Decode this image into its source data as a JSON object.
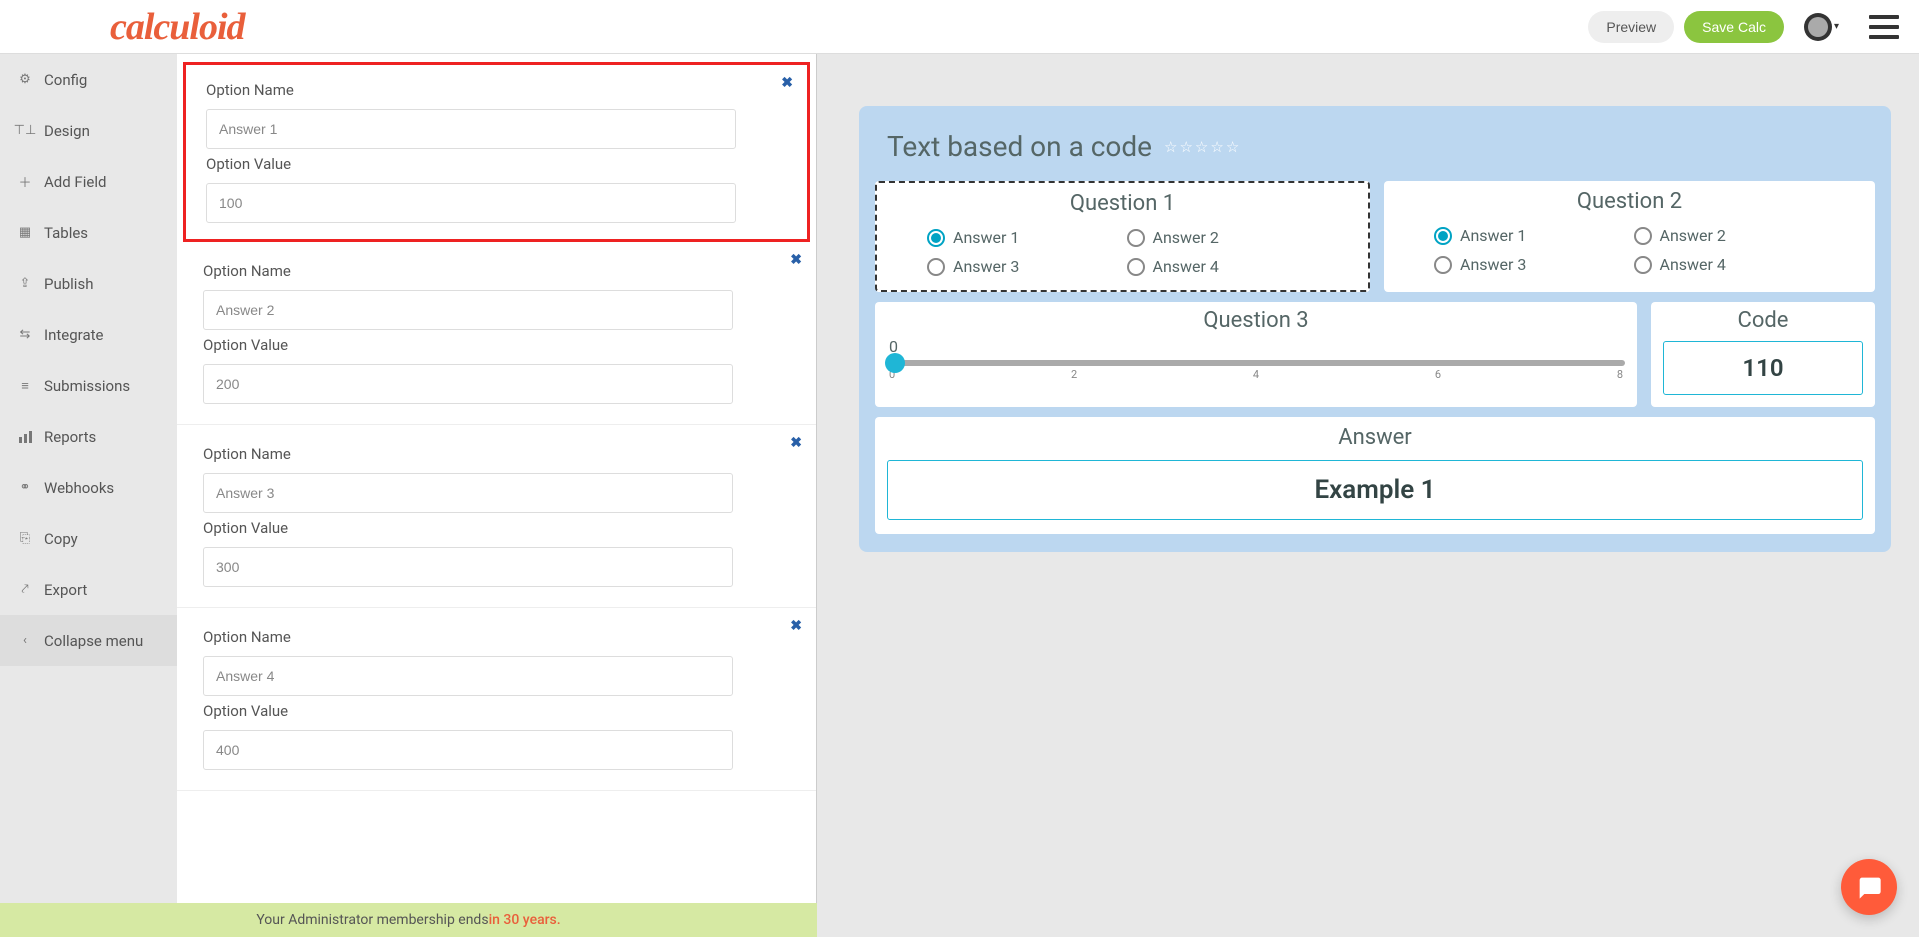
{
  "header": {
    "logo_text": "calculoid",
    "preview_label": "Preview",
    "save_label": "Save Calc"
  },
  "sidebar": {
    "items": [
      {
        "icon": "gear",
        "label": "Config"
      },
      {
        "icon": "design",
        "label": "Design"
      },
      {
        "icon": "plus",
        "label": "Add Field"
      },
      {
        "icon": "table",
        "label": "Tables"
      },
      {
        "icon": "publish",
        "label": "Publish"
      },
      {
        "icon": "integrate",
        "label": "Integrate"
      },
      {
        "icon": "list",
        "label": "Submissions"
      },
      {
        "icon": "chart",
        "label": "Reports"
      },
      {
        "icon": "webhook",
        "label": "Webhooks"
      },
      {
        "icon": "copy",
        "label": "Copy"
      },
      {
        "icon": "export",
        "label": "Export"
      }
    ],
    "collapse_label": "Collapse menu"
  },
  "editor": {
    "option_name_label": "Option Name",
    "option_value_label": "Option Value",
    "options": [
      {
        "name": "Answer 1",
        "value": "100",
        "highlighted": true
      },
      {
        "name": "Answer 2",
        "value": "200"
      },
      {
        "name": "Answer 3",
        "value": "300"
      },
      {
        "name": "Answer 4",
        "value": "400"
      }
    ]
  },
  "preview": {
    "title": "Text based on a code",
    "q1": {
      "title": "Question 1",
      "answers": [
        "Answer 1",
        "Answer 2",
        "Answer 3",
        "Answer 4"
      ],
      "selected": 0
    },
    "q2": {
      "title": "Question 2",
      "answers": [
        "Answer 1",
        "Answer 2",
        "Answer 3",
        "Answer 4"
      ],
      "selected": 0
    },
    "q3": {
      "title": "Question 3",
      "value": "0",
      "ticks": [
        "0",
        "2",
        "4",
        "6",
        "8"
      ]
    },
    "code": {
      "title": "Code",
      "value": "110"
    },
    "answer": {
      "title": "Answer",
      "value": "Example 1"
    }
  },
  "footer": {
    "prefix": "Your Administrator membership ends ",
    "expiry": "in 30 years."
  },
  "icons": {
    "gear": "⚙",
    "design": "⊤⊥",
    "plus": "＋",
    "table": "▦",
    "publish": "⇪",
    "integrate": "⇆",
    "list": "≡",
    "chart": "📊",
    "webhook": "⚭",
    "copy": "⎘",
    "export": "⤤",
    "chevron-left": "‹",
    "close": "✖"
  }
}
